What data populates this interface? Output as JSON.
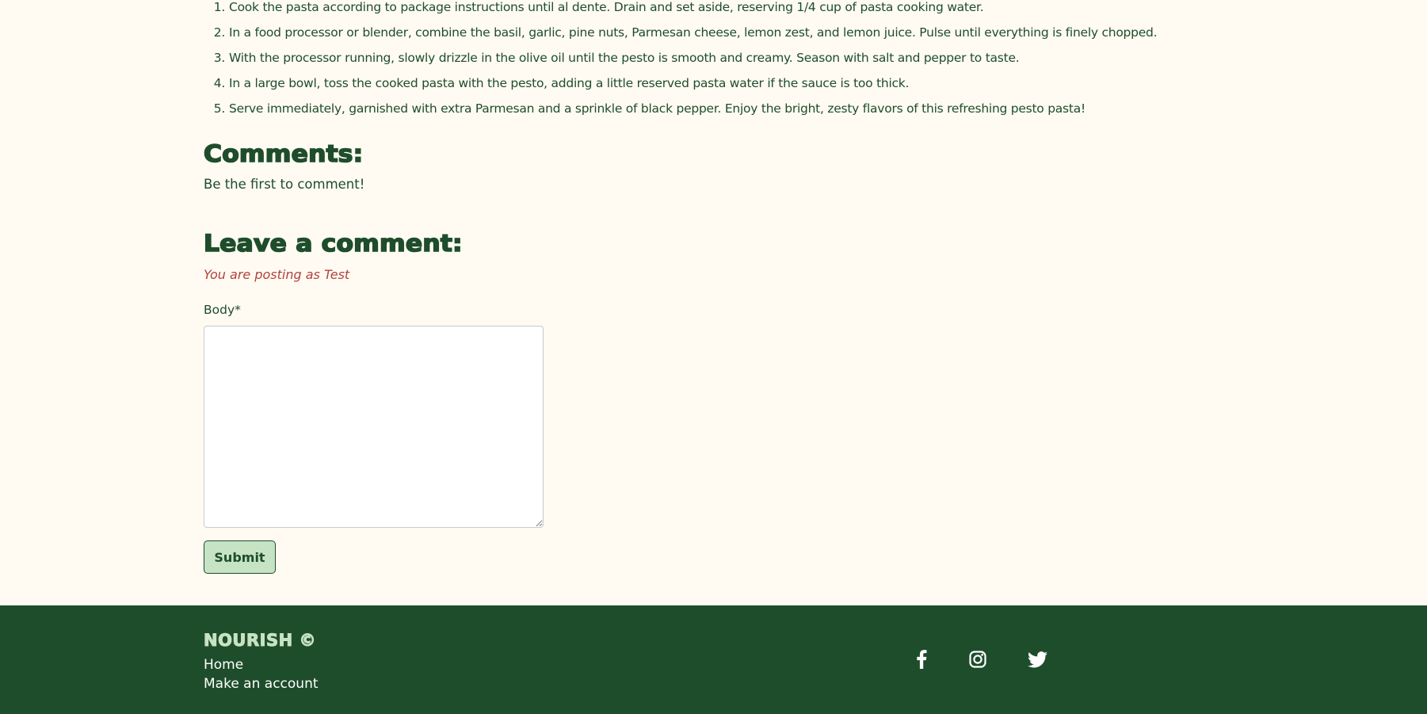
{
  "recipe": {
    "steps": [
      {
        "num": "1.",
        "text": "Cook the pasta according to package instructions until al dente. Drain and set aside, reserving 1/4 cup of pasta cooking water."
      },
      {
        "num": "2.",
        "text": "In a food processor or blender, combine the basil, garlic, pine nuts, Parmesan cheese, lemon zest, and lemon juice. Pulse until everything is finely chopped."
      },
      {
        "num": "3.",
        "text": "With the processor running, slowly drizzle in the olive oil until the pesto is smooth and creamy. Season with salt and pepper to taste."
      },
      {
        "num": "4.",
        "text": "In a large bowl, toss the cooked pasta with the pesto, adding a little reserved pasta water if the sauce is too thick."
      },
      {
        "num": "5.",
        "text": "Serve immediately, garnished with extra Parmesan and a sprinkle of black pepper. Enjoy the bright, zesty flavors of this refreshing pesto pasta!"
      }
    ]
  },
  "comments": {
    "heading": "Comments:",
    "empty_note": "Be the first to comment!"
  },
  "comment_form": {
    "heading": "Leave a comment:",
    "posting_as": "You are posting as Test",
    "body_label": "Body*",
    "body_value": "",
    "submit_label": "Submit"
  },
  "footer": {
    "brand": "NOURISH ©",
    "links": [
      "Home",
      "Make an account"
    ],
    "social_icons": [
      "facebook-icon",
      "instagram-icon",
      "twitter-icon"
    ]
  },
  "colors": {
    "page_background": "#fffbf2",
    "primary_green": "#1e4d2b",
    "light_green": "#c6e3c4",
    "posting_as_red": "#b2423e",
    "footer_text": "#ffffff"
  }
}
